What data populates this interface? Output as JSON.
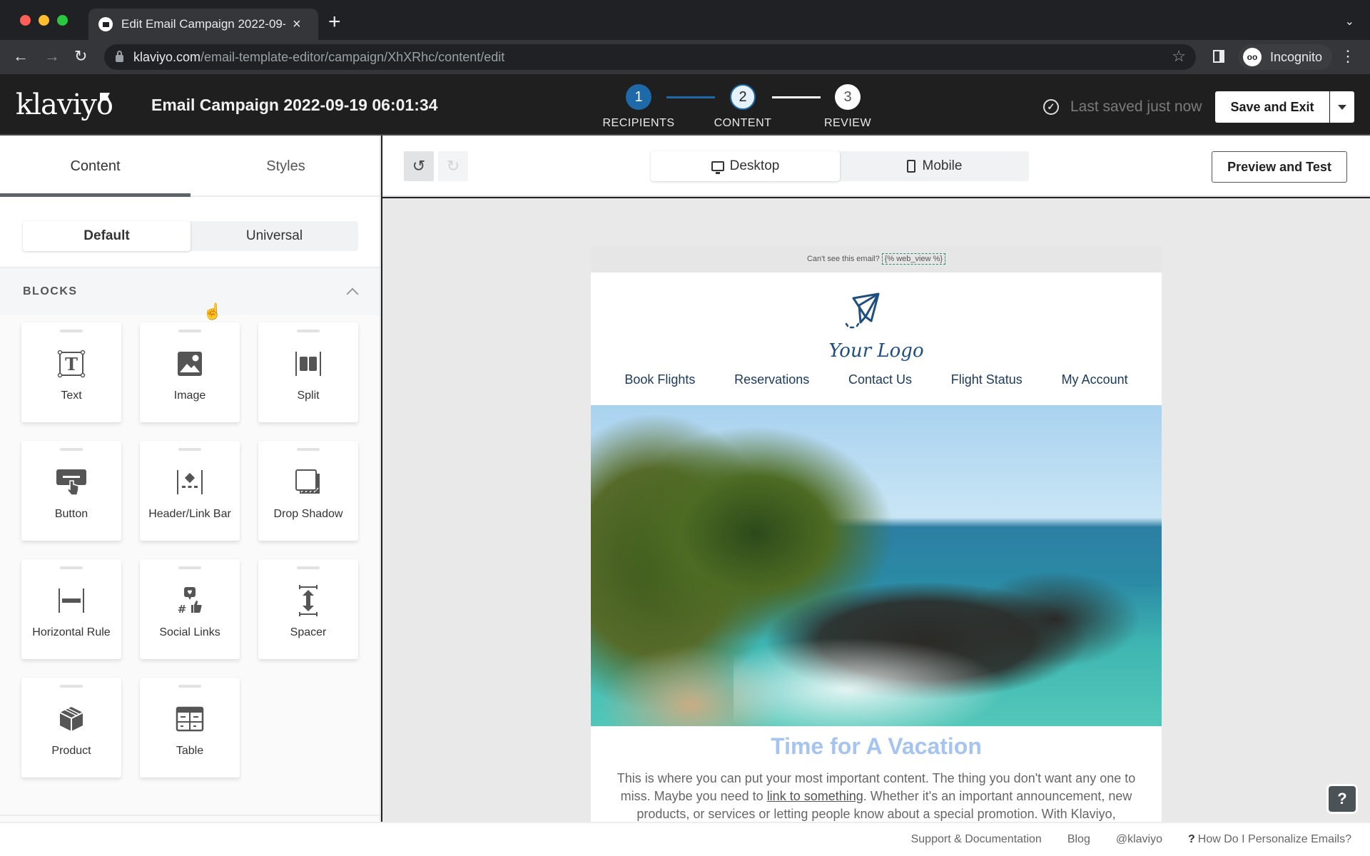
{
  "browser": {
    "tab_title": "Edit Email Campaign 2022-09-",
    "url_host": "klaviyo.com",
    "url_path": "/email-template-editor/campaign/XhXRhc/content/edit",
    "profile_label": "Incognito"
  },
  "header": {
    "logo": "klaviyo",
    "campaign_title": "Email Campaign 2022-09-19 06:01:34",
    "steps": [
      {
        "number": "1",
        "label": "RECIPIENTS",
        "state": "complete"
      },
      {
        "number": "2",
        "label": "CONTENT",
        "state": "current"
      },
      {
        "number": "3",
        "label": "REVIEW",
        "state": "upcoming"
      }
    ],
    "saved_status": "Last saved just now",
    "save_exit_label": "Save and Exit"
  },
  "sidebar": {
    "tabs": [
      {
        "label": "Content",
        "active": true
      },
      {
        "label": "Styles",
        "active": false
      }
    ],
    "segment": [
      {
        "label": "Default",
        "active": true
      },
      {
        "label": "Universal",
        "active": false
      }
    ],
    "blocks_title": "BLOCKS",
    "blocks": [
      {
        "label": "Text",
        "icon": "text-icon"
      },
      {
        "label": "Image",
        "icon": "image-icon"
      },
      {
        "label": "Split",
        "icon": "split-icon"
      },
      {
        "label": "Button",
        "icon": "button-icon"
      },
      {
        "label": "Header/Link Bar",
        "icon": "header-link-bar-icon"
      },
      {
        "label": "Drop Shadow",
        "icon": "drop-shadow-icon"
      },
      {
        "label": "Horizontal Rule",
        "icon": "horizontal-rule-icon"
      },
      {
        "label": "Social Links",
        "icon": "social-links-icon"
      },
      {
        "label": "Spacer",
        "icon": "spacer-icon"
      },
      {
        "label": "Product",
        "icon": "product-icon"
      },
      {
        "label": "Table",
        "icon": "table-icon"
      }
    ]
  },
  "toolbar": {
    "undo_icon": "↺",
    "redo_icon": "↻",
    "devices": [
      {
        "label": "Desktop",
        "active": true
      },
      {
        "label": "Mobile",
        "active": false
      }
    ],
    "preview_label": "Preview and Test"
  },
  "email": {
    "preheader_text": "Can't see this email?",
    "web_view_tag": "{% web_view %}",
    "logo_text": "Your Logo",
    "nav_links": [
      "Book Flights",
      "Reservations",
      "Contact Us",
      "Flight Status",
      "My Account"
    ],
    "headline": "Time for A Vacation",
    "body_before_link": "This is where you can put your most important content. The thing you don't want any one to miss. Maybe you need to ",
    "body_link": "link to something",
    "body_after_link": ". Whether it's an important announcement, new products, or services or letting people know about a special promotion. With Klaviyo,"
  },
  "help_button": "?",
  "footer": {
    "links": [
      "Support & Documentation",
      "Blog",
      "@klaviyo"
    ],
    "help_link": "How Do I Personalize Emails?"
  }
}
